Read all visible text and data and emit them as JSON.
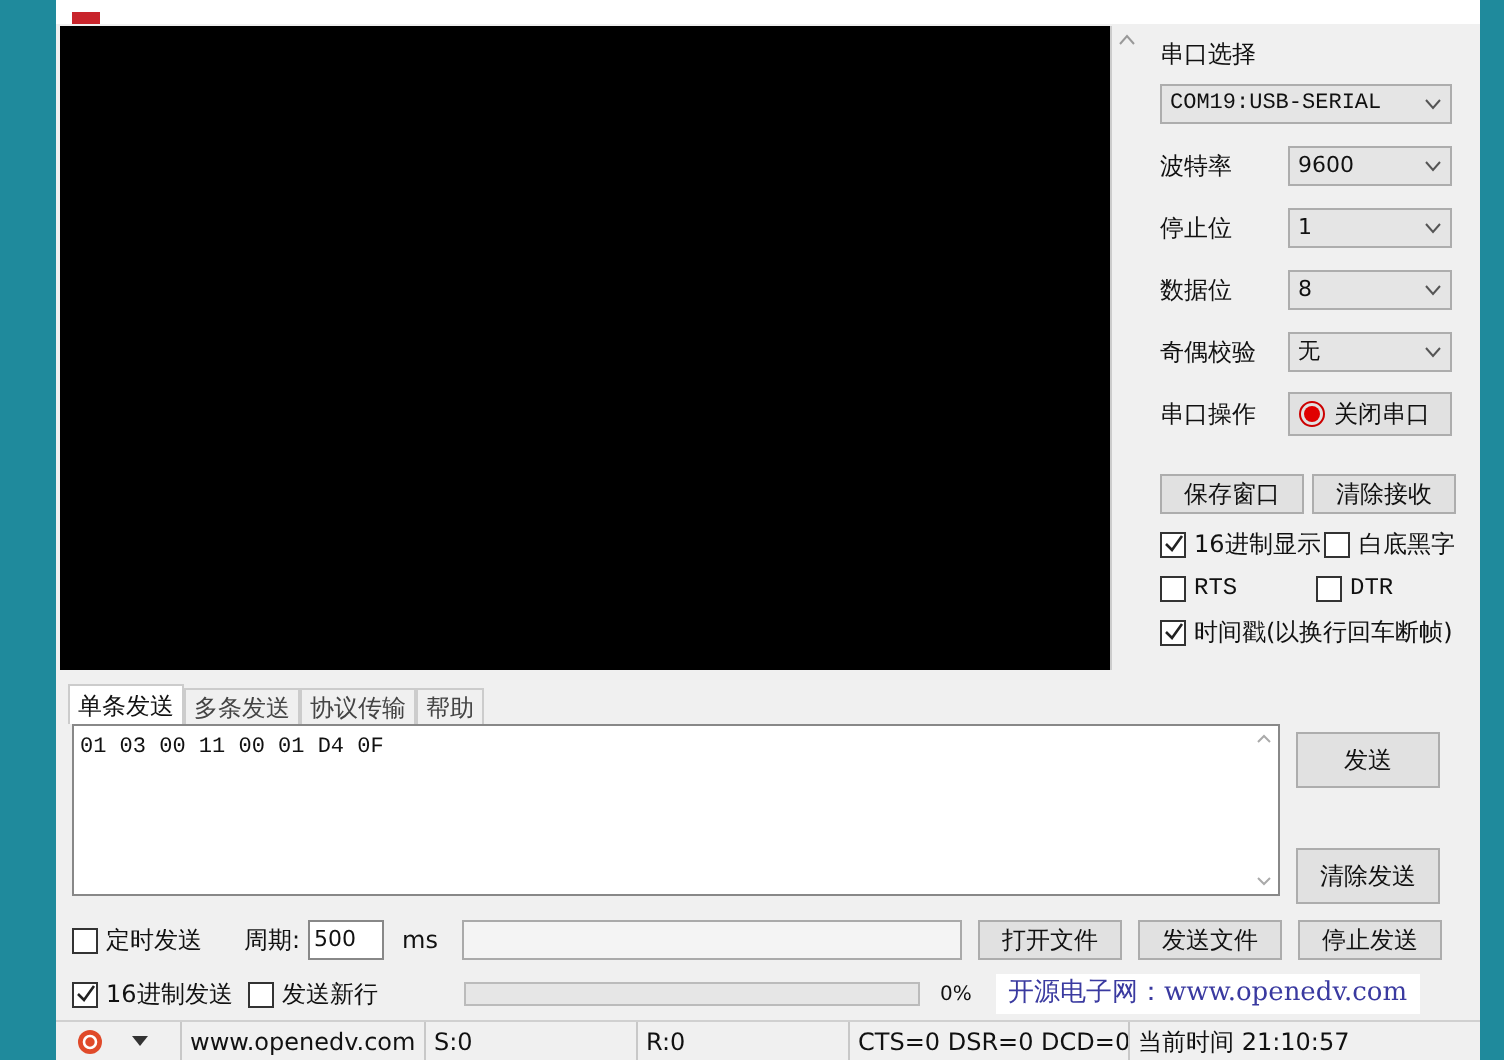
{
  "port_panel": {
    "title": "串口选择",
    "port": "COM19:USB-SERIAL",
    "settings": [
      {
        "label": "波特率",
        "value": "9600"
      },
      {
        "label": "停止位",
        "value": "1"
      },
      {
        "label": "数据位",
        "value": "8"
      },
      {
        "label": "奇偶校验",
        "value": "无"
      }
    ],
    "operation": {
      "label": "串口操作",
      "button": "关闭串口",
      "open": true
    },
    "buttons": [
      "保存窗口",
      "清除接收"
    ],
    "options": [
      {
        "label": "16进制显示",
        "checked": true
      },
      {
        "label": "白底黑字",
        "checked": false
      },
      {
        "label": "RTS",
        "checked": false
      },
      {
        "label": "DTR",
        "checked": false
      },
      {
        "label": "时间戳(以换行回车断帧)",
        "checked": true
      }
    ]
  },
  "tabs": [
    {
      "label": "单条发送",
      "selected": true
    },
    {
      "label": "多条发送",
      "selected": false
    },
    {
      "label": "协议传输",
      "selected": false
    },
    {
      "label": "帮助",
      "selected": false
    }
  ],
  "send_text": "01 03 00 11 00 01 D4 0F",
  "send_buttons": [
    "发送",
    "清除发送"
  ],
  "timer": {
    "label": "定时发送",
    "checked": false,
    "period_label": "周期:",
    "period": "500",
    "unit": "ms"
  },
  "file_buttons": [
    "打开文件",
    "发送文件",
    "停止发送"
  ],
  "hex_send": {
    "label": "16进制发送",
    "checked": true
  },
  "newline": {
    "label": "发送新行",
    "checked": false
  },
  "progress": {
    "level": 0,
    "reading": "0%"
  },
  "banner": "开源电子网：www.openedv.com",
  "status_bar": [
    "www.openedv.com",
    "S:0",
    "R:0",
    "CTS=0 DSR=0 DCD=0",
    "当前时间 21:10:57"
  ]
}
